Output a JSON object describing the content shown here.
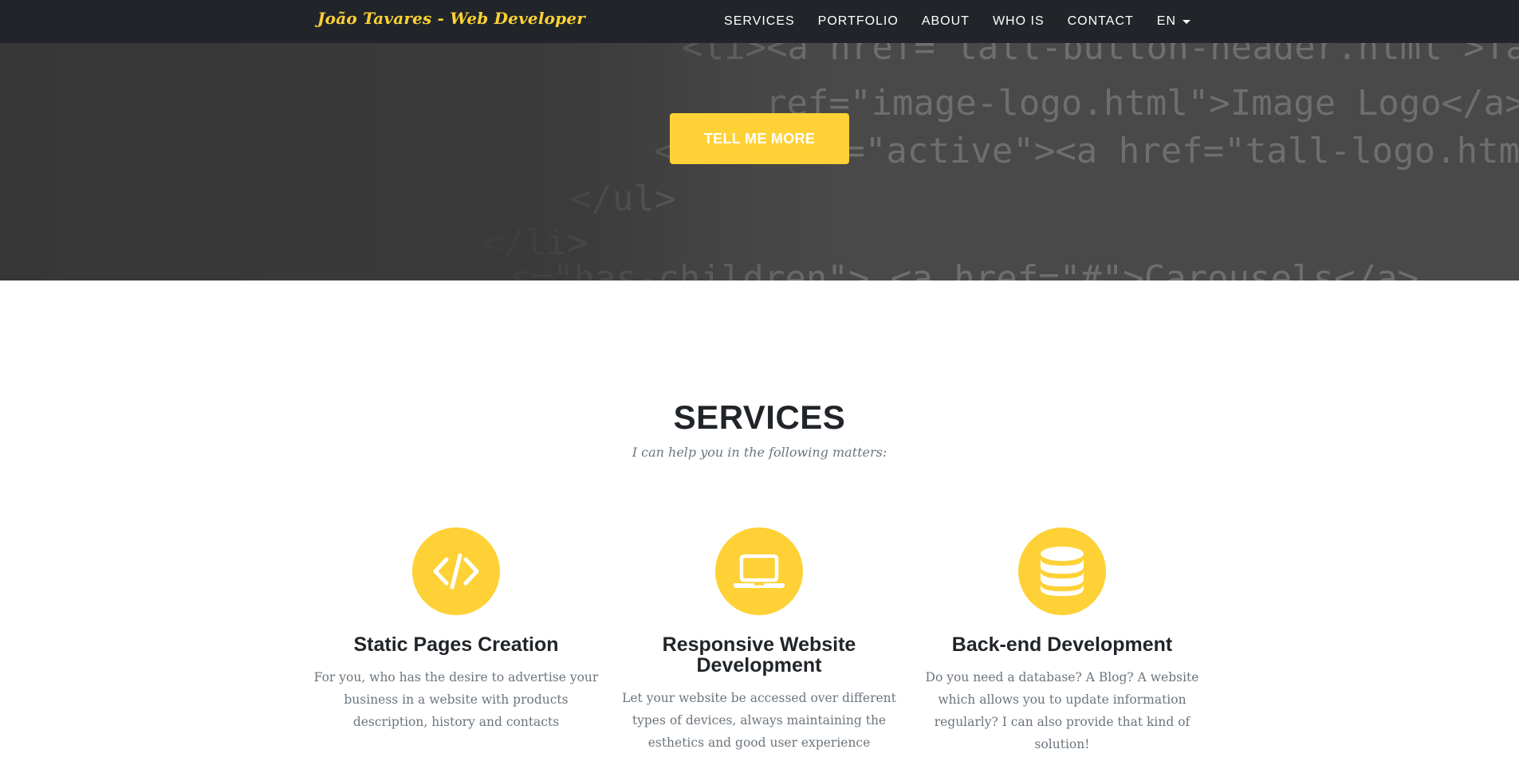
{
  "navbar": {
    "brand": "João Tavares - Web Developer",
    "links": [
      "SERVICES",
      "PORTFOLIO",
      "ABOUT",
      "WHO IS",
      "CONTACT"
    ],
    "language": "EN"
  },
  "hero": {
    "button_label": "TELL ME MORE",
    "code_lines": [
      "<li><a href=\"tall-button-header.html\">Tall Button",
      "ref=\"image-logo.html\">Image Logo</a></",
      "<li class=\"active\"><a href=\"tall-logo.html\">Ta",
      "</ul>",
      "</li>",
      "s=\"has-children\"> <a href=\"#\">Carousels</a>"
    ]
  },
  "services": {
    "title": "SERVICES",
    "subtitle": "I can help you in the following matters:",
    "items": [
      {
        "icon": "code-icon",
        "title": "Static Pages Creation",
        "description": "For you, who has the desire to advertise your business in a website with products description, history and contacts"
      },
      {
        "icon": "laptop-icon",
        "title": "Responsive Website Development",
        "description": "Let your website be accessed over different types of devices, always maintaining the esthetics and good user experience"
      },
      {
        "icon": "database-icon",
        "title": "Back-end Development",
        "description": "Do you need a database? A Blog? A website which allows you to update information regularly? I can also provide that kind of solution!"
      }
    ]
  },
  "colors": {
    "accent": "#fed136",
    "navbar_bg": "#212529",
    "heading": "#212529",
    "muted_text": "#6c757d"
  }
}
